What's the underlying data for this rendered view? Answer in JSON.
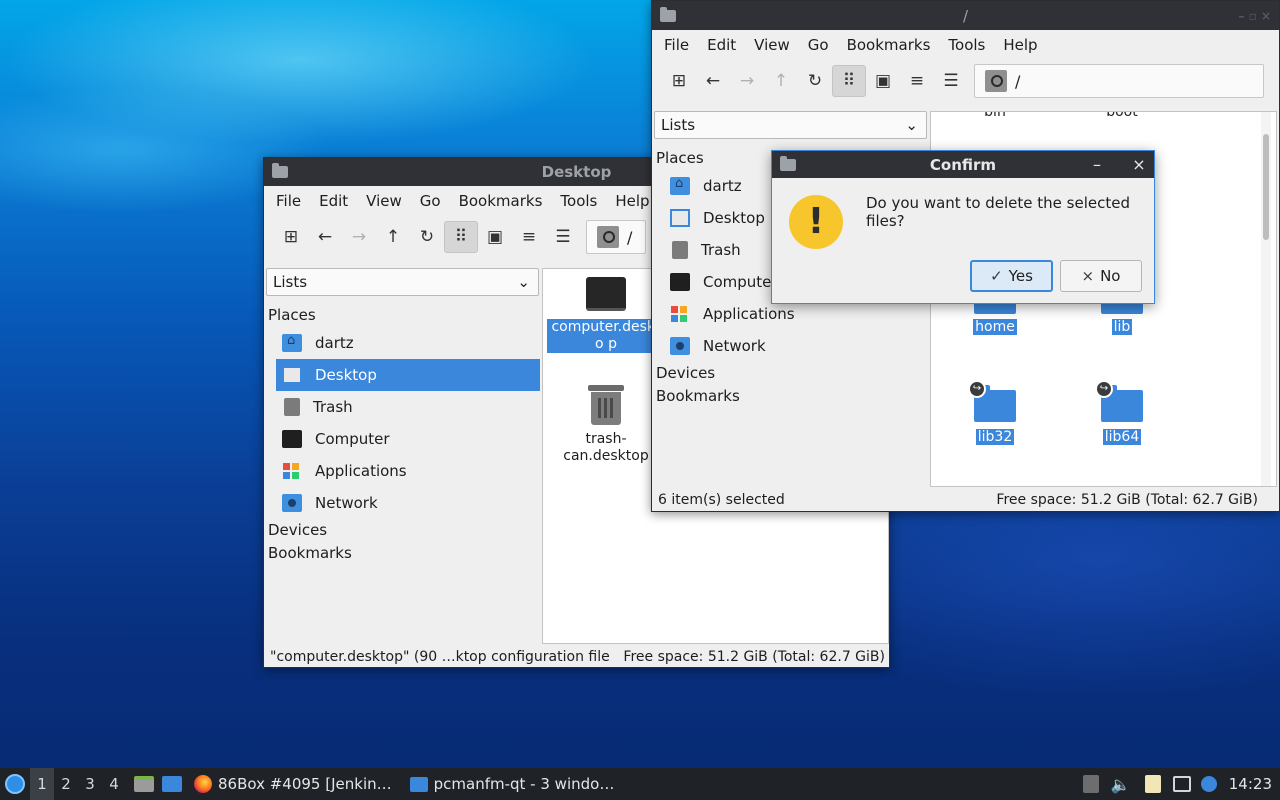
{
  "colors": {
    "accent": "#3a87dc",
    "titlebar": "#2f3136",
    "warning": "#f7c52c"
  },
  "menus": [
    "File",
    "Edit",
    "View",
    "Go",
    "Bookmarks",
    "Tools",
    "Help"
  ],
  "path": "/",
  "side_pane_mode": "Lists",
  "places_label": "Places",
  "devices_label": "Devices",
  "bookmarks_label": "Bookmarks",
  "places": [
    "dartz",
    "Desktop",
    "Trash",
    "Computer",
    "Applications",
    "Network"
  ],
  "desktop_window": {
    "title": "Desktop",
    "files": [
      {
        "name": "computer.deskto p",
        "selected": true
      },
      {
        "name": "trash- can.desktop",
        "selected": false
      }
    ],
    "status_left": "\"computer.desktop\" (90 …ktop configuration file",
    "status_right": "Free space: 51.2 GiB (Total: 62.7 GiB)"
  },
  "root_window": {
    "title": "/",
    "partial_files": [
      "bin",
      "boot"
    ],
    "files": [
      "home",
      "lib",
      "lib32",
      "lib64"
    ],
    "status_left": "6 item(s) selected",
    "status_right": "Free space: 51.2 GiB (Total: 62.7 GiB)"
  },
  "dialog": {
    "title": "Confirm",
    "message": "Do you want to delete the selected files?",
    "yes": "Yes",
    "no": "No"
  },
  "panel": {
    "workspaces": [
      "1",
      "2",
      "3",
      "4"
    ],
    "tasks": [
      "86Box #4095 [Jenkin…",
      "pcmanfm-qt - 3 windo…"
    ],
    "clock": "14:23"
  }
}
